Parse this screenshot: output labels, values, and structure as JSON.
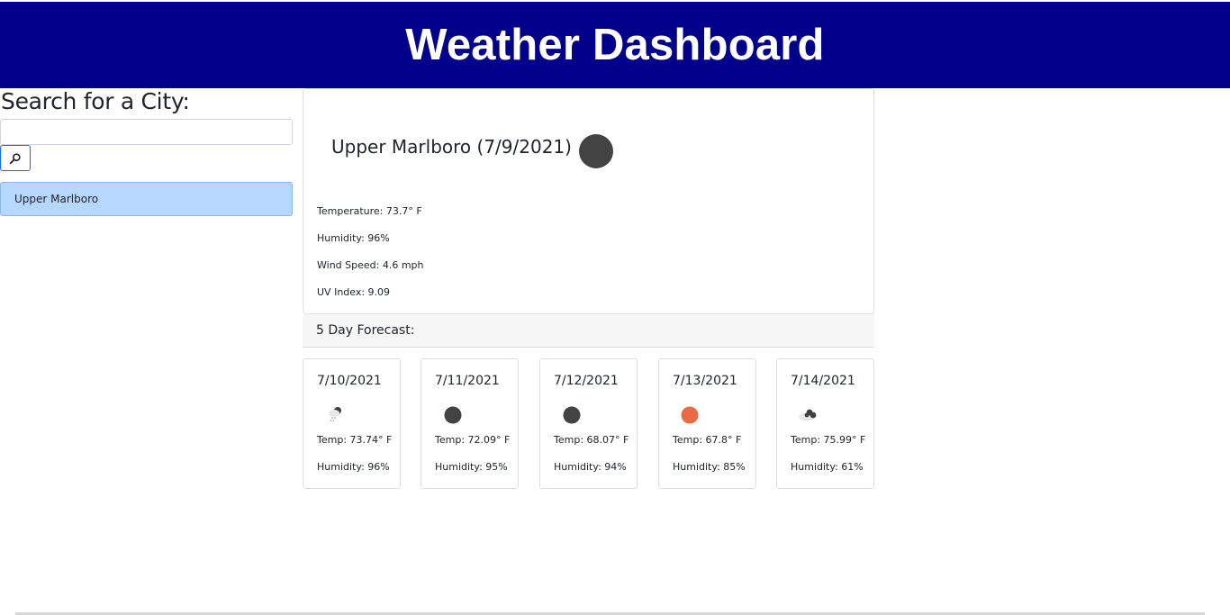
{
  "header": {
    "title": "Weather Dashboard"
  },
  "sidebar": {
    "title": "Search for a City:",
    "search": {
      "value": "",
      "placeholder": ""
    },
    "search_button_icon": "search-icon",
    "history": [
      {
        "label": "Upper Marlboro"
      }
    ]
  },
  "current": {
    "title": "Upper Marlboro (7/9/2021)",
    "icon": "weather-icon-dark-circle",
    "temperature": "Temperature: 73.7° F",
    "humidity": "Humidity: 96%",
    "wind": "Wind Speed: 4.6 mph",
    "uv": "UV Index: 9.09"
  },
  "forecast": {
    "title": "5 Day Forecast:",
    "days": [
      {
        "date": "7/10/2021",
        "icon": "rain-cloud-icon",
        "temp": "Temp: 73.74° F",
        "humidity": "Humidity: 96%"
      },
      {
        "date": "7/11/2021",
        "icon": "dark-circle-icon",
        "temp": "Temp: 72.09° F",
        "humidity": "Humidity: 95%"
      },
      {
        "date": "7/12/2021",
        "icon": "dark-circle-icon",
        "temp": "Temp: 68.07° F",
        "humidity": "Humidity: 94%"
      },
      {
        "date": "7/13/2021",
        "icon": "sun-icon",
        "temp": "Temp: 67.8° F",
        "humidity": "Humidity: 85%"
      },
      {
        "date": "7/14/2021",
        "icon": "broken-clouds-icon",
        "temp": "Temp: 75.99° F",
        "humidity": "Humidity: 61%"
      }
    ]
  },
  "colors": {
    "header_bg": "#00008b",
    "history_bg": "#b6d7fe",
    "sun": "#ea6a47",
    "dark_icon": "#434343"
  }
}
